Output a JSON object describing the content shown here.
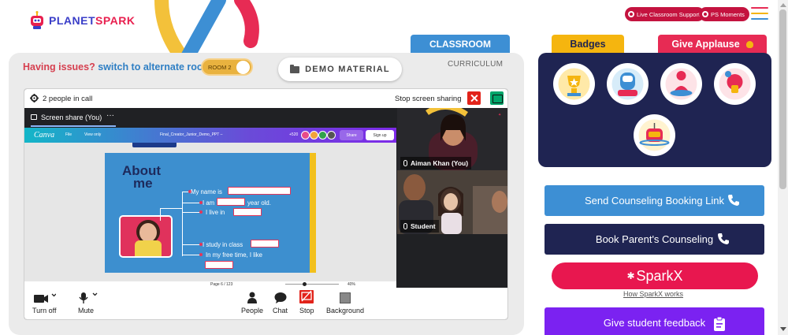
{
  "header": {
    "logo_planet": "PLANET",
    "logo_spark": "SPARK",
    "live_support_label": "Live Classroom Support",
    "ps_moments_label": "PS Moments"
  },
  "tabs": {
    "classroom": "CLASSROOM",
    "curriculum": "CURRICULUM"
  },
  "issues": {
    "question": "Having issues?",
    "switch_text": "switch to alternate room"
  },
  "room_toggle": {
    "label": "ROOM 2"
  },
  "demo_button": {
    "label": "DEMO MATERIAL"
  },
  "call": {
    "people_count": "2 people in call",
    "stop_sharing": "Stop screen sharing",
    "share_tab_label": "Screen share (You)",
    "share_menu": "···",
    "tiles": [
      {
        "name": "Aiman Khan (You)"
      },
      {
        "name": "Student"
      }
    ],
    "controls": [
      {
        "label": "Turn off"
      },
      {
        "label": "Mute"
      },
      {
        "label": "People"
      },
      {
        "label": "Chat"
      },
      {
        "label": "Stop"
      },
      {
        "label": "Background"
      }
    ]
  },
  "slide": {
    "canva_logo": "Canva",
    "menu_file": "File",
    "menu_view": "View only",
    "doc_title": "Final_Creator_Junior_Demo_PPT –",
    "collab_count": "+520",
    "share": "Share",
    "signup": "Sign up",
    "title_line1": "About",
    "title_line2": "me",
    "line_name": "My name is",
    "line_age_prefix": "I am",
    "line_age_suffix": "year old.",
    "line_live": "I live in",
    "line_study": "I study in class",
    "line_free": "In my free time, I like",
    "page_indicator": "Page 6 / 123",
    "zoom": "40%"
  },
  "right": {
    "badges_tab": "Badges",
    "applause_tab": "Give Applause",
    "send_counseling": "Send Counseling Booking Link",
    "book_counseling": "Book Parent's Counseling",
    "sparkx": "SparkX",
    "sparkx_link": "How SparkX works",
    "feedback": "Give student feedback"
  },
  "colors": {
    "brand_blue": "#3a3ec8",
    "brand_red": "#e8204f",
    "classroom_tab": "#3d8fd4",
    "badge_panel": "#1f2452",
    "send_counseling_btn": "#3d8fd4",
    "book_counseling_btn": "#1f2452",
    "sparkx_btn": "#e8174f",
    "feedback_btn": "#7b22f1",
    "badges_tab": "#f5b50f",
    "applause_tab": "#e72b54"
  }
}
